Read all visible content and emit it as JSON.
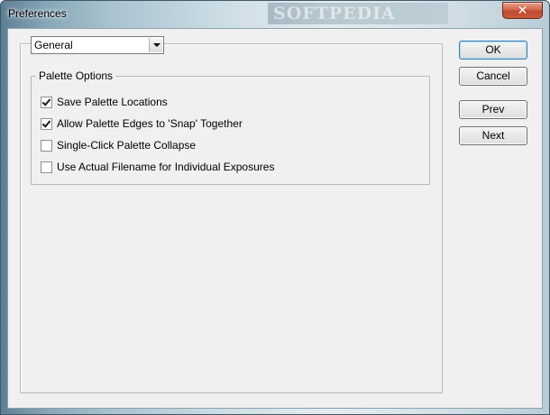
{
  "window": {
    "title": "Preferences",
    "watermark": "SOFTPEDIA",
    "close_glyph": "✕"
  },
  "category_select": {
    "value": "General"
  },
  "palette_options": {
    "legend": "Palette Options",
    "items": [
      {
        "label": "Save Palette Locations",
        "checked": true
      },
      {
        "label": "Allow Palette Edges to 'Snap' Together",
        "checked": true
      },
      {
        "label": "Single-Click Palette Collapse",
        "checked": false
      },
      {
        "label": "Use Actual Filename for Individual Exposures",
        "checked": false
      }
    ]
  },
  "buttons": {
    "ok": "OK",
    "cancel": "Cancel",
    "prev": "Prev",
    "next": "Next"
  },
  "colors": {
    "close_button": "#c75a3c",
    "dialog_background": "#f0f0f0"
  }
}
